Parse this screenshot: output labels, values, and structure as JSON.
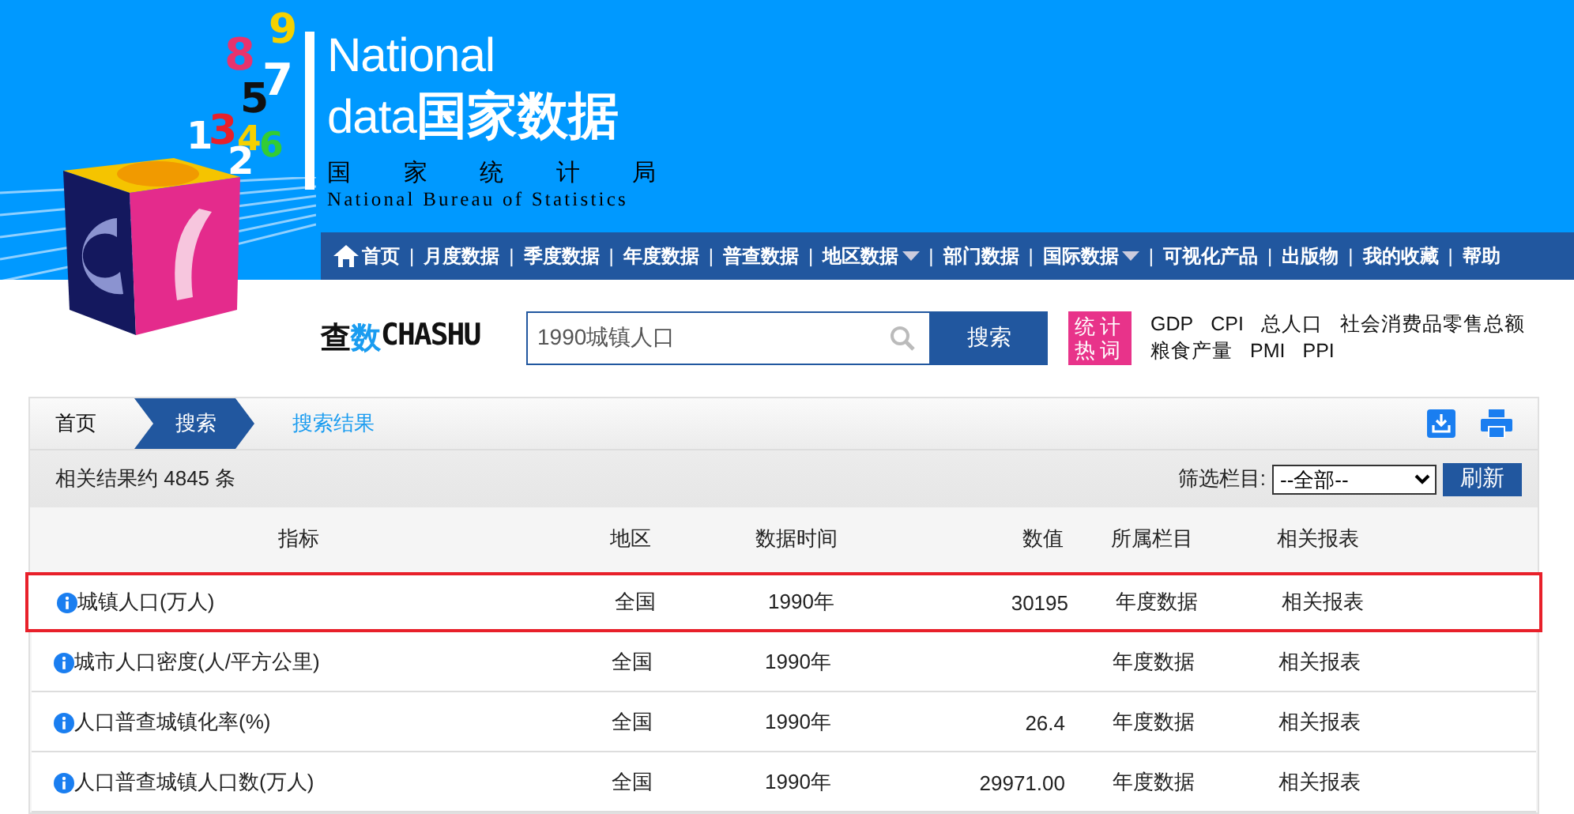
{
  "banner": {
    "title_latin_1": "National",
    "title_latin_2": "data",
    "title_cn": "国家数据",
    "bureau_cn": [
      "国",
      "家",
      "统",
      "计",
      "局"
    ],
    "bureau_en": "National Bureau of Statistics",
    "logo_digits": [
      {
        "text": "9",
        "color": "#f5d100"
      },
      {
        "text": "8",
        "color": "#e8336d"
      },
      {
        "text": "7",
        "color": "#ffffff"
      },
      {
        "text": "5",
        "color": "#111111"
      },
      {
        "text": "1",
        "color": "#ffffff"
      },
      {
        "text": "3",
        "color": "#e8202a"
      },
      {
        "text": "4",
        "color": "#f5d100"
      },
      {
        "text": "6",
        "color": "#33cc33"
      },
      {
        "text": "2",
        "color": "#ffffff"
      }
    ]
  },
  "nav": [
    {
      "label": "首页",
      "home": true,
      "has_menu": false
    },
    {
      "separator": "|",
      "label": "月度数据",
      "home": false,
      "has_menu": false
    },
    {
      "separator": "|",
      "label": "季度数据",
      "home": false,
      "has_menu": false
    },
    {
      "separator": "|",
      "label": "年度数据",
      "home": false,
      "has_menu": false
    },
    {
      "separator": "|",
      "label": "普查数据",
      "home": false,
      "has_menu": false
    },
    {
      "separator": "|",
      "label": "地区数据",
      "home": false,
      "has_menu": true
    },
    {
      "separator": "|",
      "label": "部门数据",
      "home": false,
      "has_menu": false
    },
    {
      "separator": "|",
      "label": "国际数据",
      "home": false,
      "has_menu": true
    },
    {
      "separator": "|",
      "label": "可视化产品",
      "home": false,
      "has_menu": false
    },
    {
      "separator": "|",
      "label": "出版物",
      "home": false,
      "has_menu": false
    },
    {
      "separator": "|",
      "label": "我的收藏",
      "home": false,
      "has_menu": false
    },
    {
      "separator": "|",
      "label": "帮助",
      "home": false,
      "has_menu": false
    }
  ],
  "search": {
    "logo_cn_1": "查",
    "logo_cn_2": "数",
    "logo_latin": "CHASHU",
    "value": "1990城镇人口",
    "button": "搜索",
    "hot_label": "统计热词",
    "hot_words": [
      "GDP",
      "CPI",
      "总人口",
      "社会消费品零售总额",
      "粮食产量",
      "PMI",
      "PPI"
    ]
  },
  "breadcrumb": [
    {
      "label": "首页",
      "selected": false
    },
    {
      "label": "搜索",
      "selected": true
    },
    {
      "label": "搜索结果",
      "selected": false
    }
  ],
  "summary": "相关结果约 4845 条",
  "filter": {
    "label": "筛选栏目:",
    "value": "--全部--",
    "button": "刷新"
  },
  "table": {
    "columns": [
      "指标",
      "地区",
      "数据时间",
      "数值",
      "所属栏目",
      "相关报表"
    ],
    "rows": [
      {
        "indicator": "城镇人口(万人)",
        "region": "全国",
        "time": "1990年",
        "value": "30195",
        "category": "年度数据",
        "report": "相关报表",
        "selected": true
      },
      {
        "indicator": "城市人口密度(人/平方公里)",
        "region": "全国",
        "time": "1990年",
        "category": "年度数据",
        "report": "相关报表",
        "selected": false
      },
      {
        "indicator": "人口普查城镇化率(%)",
        "region": "全国",
        "time": "1990年",
        "value": "26.4",
        "category": "年度数据",
        "report": "相关报表",
        "selected": false
      },
      {
        "indicator": "人口普查城镇人口数(万人)",
        "region": "全国",
        "time": "1990年",
        "value": "29971.00",
        "category": "年度数据",
        "report": "相关报表",
        "selected": false
      }
    ]
  }
}
